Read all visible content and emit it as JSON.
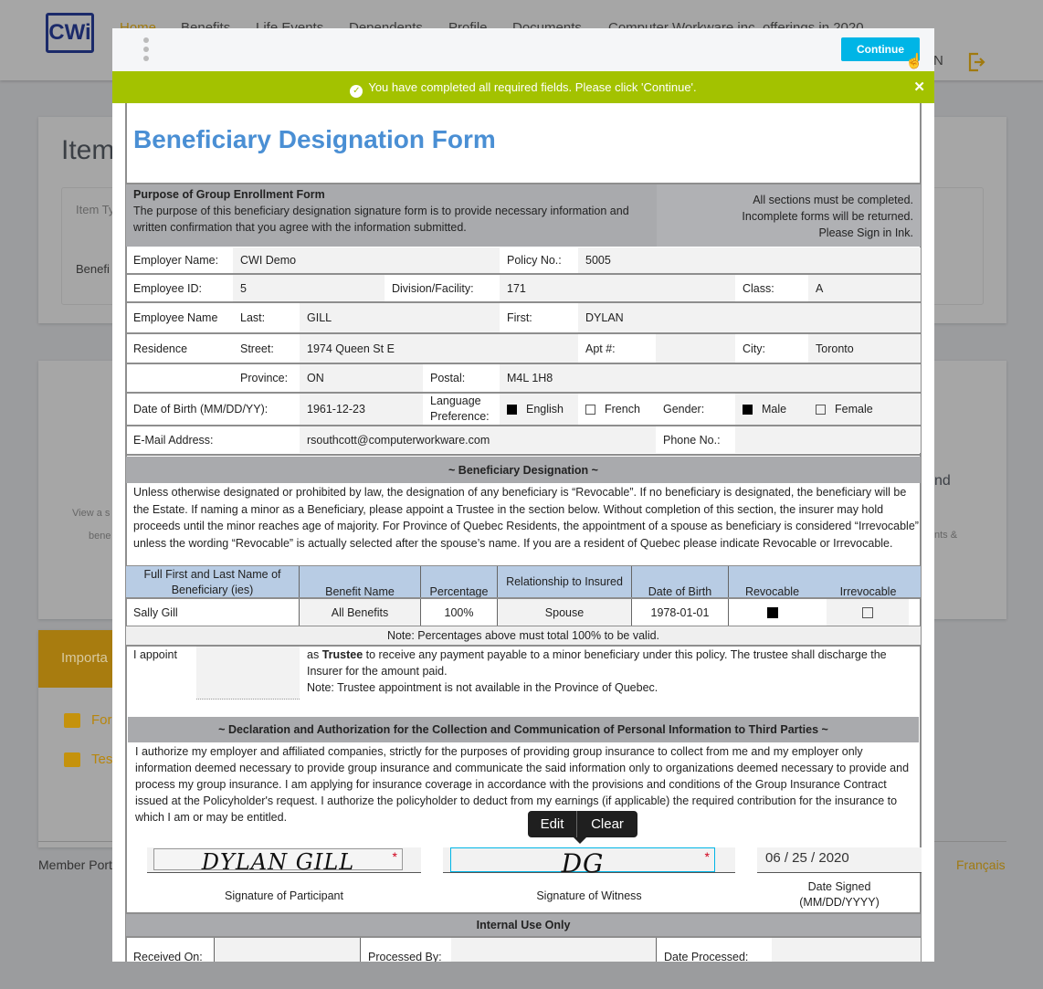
{
  "app": {
    "logo": "CWi",
    "nav": [
      "Home",
      "Benefits",
      "Life Events",
      "Dependents",
      "Profile",
      "Documents",
      "Computer Workware inc. offerings in 2020"
    ],
    "user_initial_fragment": "N"
  },
  "background": {
    "card1_title": "Item",
    "card1_col": "Item Ty",
    "card1_cell": "Benefi",
    "card2_text1": "View a s",
    "card2_text2": "bene",
    "card2_right1": "nd",
    "card2_right2": "nts &",
    "important_title": "Importa",
    "important_items": [
      "For",
      "Tes"
    ],
    "footer_left": "Member Port",
    "footer_lang": "Français"
  },
  "modal": {
    "continue_label": "Continue",
    "banner": "You have completed all required fields. Please click 'Continue'.",
    "close": "✕"
  },
  "form": {
    "title": "Beneficiary Designation Form",
    "purpose_title": "Purpose of Group Enrollment Form",
    "purpose_text": "The purpose of this beneficiary designation signature form is to provide necessary information and written confirmation that you agree with the information submitted.",
    "notice": [
      "All sections must be completed.",
      "Incomplete forms will be returned.",
      "Please Sign in Ink."
    ],
    "employer_name_label": "Employer Name:",
    "employer_name": "CWI Demo",
    "policy_label": "Policy No.:",
    "policy": "5005",
    "employee_id_label": "Employee ID:",
    "employee_id": "5",
    "division_label": "Division/Facility:",
    "division": "171",
    "class_label": "Class:",
    "class": "A",
    "employee_name_label": "Employee Name",
    "last_label": "Last:",
    "last": "GILL",
    "first_label": "First:",
    "first": "DYLAN",
    "residence_label": "Residence",
    "street_label": "Street:",
    "street": "1974 Queen St E",
    "apt_label": "Apt #:",
    "apt": "",
    "city_label": "City:",
    "city": "Toronto",
    "province_label": "Province:",
    "province": "ON",
    "postal_label": "Postal:",
    "postal": "M4L 1H8",
    "dob_label": "Date of Birth (MM/DD/YY):",
    "dob": "1961-12-23",
    "language_label": "Language Preference:",
    "lang_english": "English",
    "lang_french": "French",
    "english_checked": true,
    "french_checked": false,
    "gender_label": "Gender:",
    "male": "Male",
    "female": "Female",
    "male_checked": true,
    "female_checked": false,
    "email_label": "E-Mail Address:",
    "email": "rsouthcott@computerworkware.com",
    "phone_label": "Phone No.:",
    "phone": "",
    "ben_header": "~ Beneficiary Designation ~",
    "ben_text": "Unless otherwise designated or prohibited by law, the designation of any beneficiary is “Revocable”.  If no beneficiary is designated, the beneficiary will be the Estate.  If naming a minor as a Beneficiary, please appoint a Trustee in the section below.  Without completion of this section, the insurer may hold proceeds until the minor reaches age of majority.  For Province of Quebec Residents, the appointment of a spouse as beneficiary is considered “Irrevocable” unless the wording “Revocable” is actually selected after the spouse’s name.  If you are a resident of Quebec please indicate Revocable or Irrevocable.",
    "table_headers": [
      "Full First and Last Name of Beneficiary (ies)",
      "Benefit Name",
      "Percentage",
      "Relationship to Insured",
      "Date of Birth",
      "Revocable",
      "Irrevocable"
    ],
    "table_row": {
      "name": "Sally Gill",
      "benefit": "All Benefits",
      "percentage": "100%",
      "relationship": "Spouse",
      "dob": "1978-01-01",
      "revocable": true,
      "irrevocable": false
    },
    "pct_note": "Note: Percentages above must total 100% to be valid.",
    "appoint_label": "I appoint",
    "trustee": "",
    "trustee_pre": "as ",
    "trustee_bold": "Trustee",
    "trustee_text": " to receive any payment payable to a minor beneficiary under this policy. The trustee shall discharge the Insurer for the amount paid.",
    "trustee_note": "Note:  Trustee appointment is not available in the Province of Quebec.",
    "decl_header": "~ Declaration and Authorization for the Collection and Communication of Personal Information to Third Parties ~",
    "decl_text": "I authorize my employer and affiliated companies, strictly for the purposes of providing group insurance to collect from me and my employer only information deemed necessary to provide group insurance and communicate the said information only to organizations deemed necessary to provide and process my group insurance.  I am applying for insurance coverage in accordance with the provisions and conditions of the Group Insurance Contract issued at the Policyholder's request.  I authorize the policyholder to deduct from my earnings (if applicable) the required contribution for the insurance to which I am or may be entitled.",
    "sig_participant": "DYLAN GILL",
    "sig_participant_label": "Signature of Participant",
    "sig_witness": "DG",
    "sig_witness_label": "Signature of Witness",
    "date_signed": "06 / 25 / 2020",
    "date_label": "Date Signed",
    "date_format": "(MM/DD/YYYY)",
    "required_mark": "*",
    "tooltip_edit": "Edit",
    "tooltip_clear": "Clear",
    "internal_header": "Internal Use Only",
    "received_label": "Received On:",
    "processed_by_label": "Processed By:",
    "date_processed_label": "Date Processed:"
  }
}
